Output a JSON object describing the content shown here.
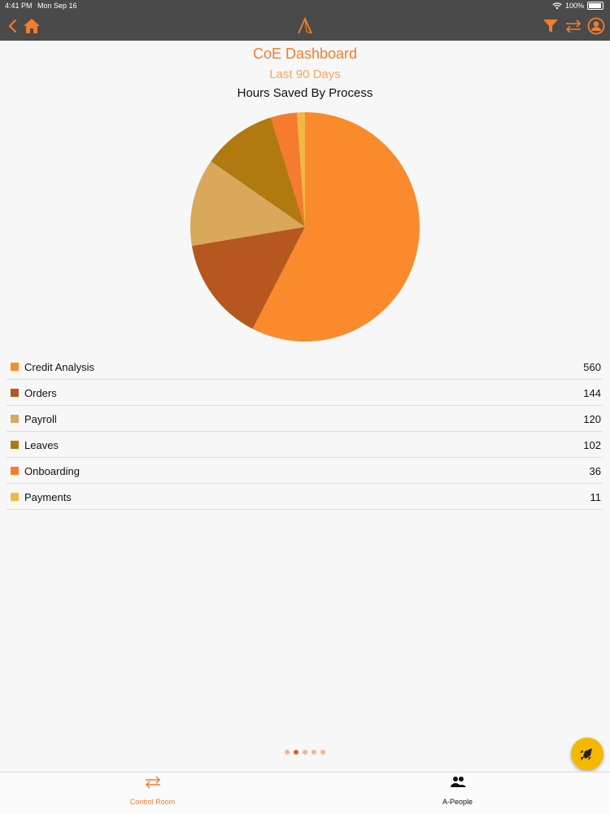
{
  "status_bar": {
    "time": "4:41 PM",
    "date": "Mon Sep 16",
    "battery": "100%"
  },
  "nav_bar": {
    "back_icon": "chevron-left-icon",
    "home_icon": "home-icon",
    "logo_icon": "app-logo-icon",
    "filter_icon": "filter-icon",
    "switch_icon": "swap-arrows-icon",
    "profile_icon": "user-icon"
  },
  "header": {
    "title": "CoE Dashboard",
    "period": "Last 90 Days",
    "chart_title": "Hours Saved By Process"
  },
  "chart_data": {
    "type": "pie",
    "title": "Hours Saved By Process",
    "categories": [
      "Credit Analysis",
      "Orders",
      "Payroll",
      "Leaves",
      "Onboarding",
      "Payments"
    ],
    "values": [
      560,
      144,
      120,
      102,
      36,
      11
    ],
    "colors": [
      "#fa8a2c",
      "#b5571f",
      "#d9a85a",
      "#b07a10",
      "#f77b2e",
      "#f2b843"
    ]
  },
  "legend": [
    {
      "label": "Credit Analysis",
      "value": "560",
      "color": "#fa8a2c"
    },
    {
      "label": "Orders",
      "value": "144",
      "color": "#b5571f"
    },
    {
      "label": "Payroll",
      "value": "120",
      "color": "#d9a85a"
    },
    {
      "label": "Leaves",
      "value": "102",
      "color": "#b07a10"
    },
    {
      "label": "Onboarding",
      "value": "36",
      "color": "#f77b2e"
    },
    {
      "label": "Payments",
      "value": "11",
      "color": "#f2b843"
    }
  ],
  "pager": {
    "count": 5,
    "active": 1
  },
  "fab": {
    "icon": "rocket-icon"
  },
  "tabs": [
    {
      "label": "Control Room",
      "icon": "swap-arrows-icon",
      "color": "#f47c2a"
    },
    {
      "label": "A-People",
      "icon": "people-icon",
      "color": "#111111"
    }
  ]
}
